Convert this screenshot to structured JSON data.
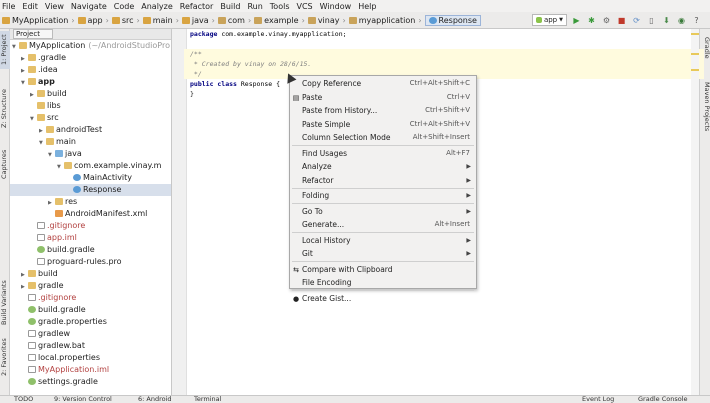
{
  "menubar": [
    "File",
    "Edit",
    "View",
    "Navigate",
    "Code",
    "Analyze",
    "Refactor",
    "Build",
    "Run",
    "Tools",
    "VCS",
    "Window",
    "Help"
  ],
  "breadcrumbs": [
    "MyApplication",
    "app",
    "src",
    "main",
    "java",
    "com",
    "example",
    "vinay",
    "myapplication",
    "Response"
  ],
  "toolbar": {
    "run_config": "app"
  },
  "left_tabs": [
    "1: Project",
    "Z: Structure",
    "Captures",
    "Build Variants",
    "2: Favorites"
  ],
  "right_tabs": [
    "Gradle",
    "Maven Projects"
  ],
  "project": {
    "view_label": "Project",
    "tree": [
      {
        "label": "MyApplication",
        "extra": "(~/AndroidStudioPro",
        "indent": 0,
        "arrow": "▼",
        "icon": "folder"
      },
      {
        "label": ".gradle",
        "indent": 1,
        "arrow": "▶",
        "icon": "folder"
      },
      {
        "label": ".idea",
        "indent": 1,
        "arrow": "▶",
        "icon": "folder"
      },
      {
        "label": "app",
        "indent": 1,
        "arrow": "▼",
        "icon": "folder",
        "bold": true
      },
      {
        "label": "build",
        "indent": 2,
        "arrow": "▶",
        "icon": "folder"
      },
      {
        "label": "libs",
        "indent": 2,
        "arrow": "",
        "icon": "folder"
      },
      {
        "label": "src",
        "indent": 2,
        "arrow": "▼",
        "icon": "folder"
      },
      {
        "label": "androidTest",
        "indent": 3,
        "arrow": "▶",
        "icon": "folder"
      },
      {
        "label": "main",
        "indent": 3,
        "arrow": "▼",
        "icon": "folder"
      },
      {
        "label": "java",
        "indent": 4,
        "arrow": "▼",
        "icon": "src"
      },
      {
        "label": "com.example.vinay.m",
        "indent": 5,
        "arrow": "▼",
        "icon": "folder"
      },
      {
        "label": "MainActivity",
        "indent": 6,
        "arrow": "",
        "icon": "cls"
      },
      {
        "label": "Response",
        "indent": 6,
        "arrow": "",
        "icon": "cls",
        "selected": true
      },
      {
        "label": "res",
        "indent": 4,
        "arrow": "▶",
        "icon": "folder"
      },
      {
        "label": "AndroidManifest.xml",
        "indent": 4,
        "arrow": "",
        "icon": "xml"
      },
      {
        "label": ".gitignore",
        "indent": 2,
        "arrow": "",
        "icon": "file"
      },
      {
        "label": "app.iml",
        "indent": 2,
        "arrow": "",
        "icon": "file"
      },
      {
        "label": "build.gradle",
        "indent": 2,
        "arrow": "",
        "icon": "gradle"
      },
      {
        "label": "proguard-rules.pro",
        "indent": 2,
        "arrow": "",
        "icon": "file"
      },
      {
        "label": "build",
        "indent": 1,
        "arrow": "▶",
        "icon": "folder"
      },
      {
        "label": "gradle",
        "indent": 1,
        "arrow": "▶",
        "icon": "folder"
      },
      {
        "label": ".gitignore",
        "indent": 1,
        "arrow": "",
        "icon": "file"
      },
      {
        "label": "build.gradle",
        "indent": 1,
        "arrow": "",
        "icon": "gradle"
      },
      {
        "label": "gradle.properties",
        "indent": 1,
        "arrow": "",
        "icon": "gradle"
      },
      {
        "label": "gradlew",
        "indent": 1,
        "arrow": "",
        "icon": "file"
      },
      {
        "label": "gradlew.bat",
        "indent": 1,
        "arrow": "",
        "icon": "file"
      },
      {
        "label": "local.properties",
        "indent": 1,
        "arrow": "",
        "icon": "file"
      },
      {
        "label": "MyApplication.iml",
        "indent": 1,
        "arrow": "",
        "icon": "file"
      },
      {
        "label": "settings.gradle",
        "indent": 1,
        "arrow": "",
        "icon": "gradle"
      }
    ]
  },
  "editor": {
    "lines": [
      {
        "text": "package com.example.vinay.myapplication;",
        "style": "pkg"
      },
      {
        "text": "",
        "style": "plain"
      },
      {
        "text": "/**",
        "style": "cmt"
      },
      {
        "text": " * Created by vinay on 28/6/15.",
        "style": "cmt"
      },
      {
        "text": " */",
        "style": "cmt"
      },
      {
        "text": "public class Response {",
        "style": "cls"
      },
      {
        "text": "}",
        "style": "plain"
      }
    ]
  },
  "context_menu": [
    {
      "label": "Copy Reference",
      "shortcut": "Ctrl+Alt+Shift+C"
    },
    {
      "label": "Paste",
      "shortcut": "Ctrl+V",
      "icon": "paste-icon"
    },
    {
      "label": "Paste from History...",
      "shortcut": "Ctrl+Shift+V"
    },
    {
      "label": "Paste Simple",
      "shortcut": "Ctrl+Alt+Shift+V"
    },
    {
      "label": "Column Selection Mode",
      "shortcut": "Alt+Shift+Insert"
    },
    {
      "sep": true
    },
    {
      "label": "Find Usages",
      "shortcut": "Alt+F7"
    },
    {
      "label": "Analyze",
      "submenu": true
    },
    {
      "label": "Refactor",
      "submenu": true
    },
    {
      "sep": true
    },
    {
      "label": "Folding",
      "submenu": true
    },
    {
      "sep": true
    },
    {
      "label": "Go To",
      "submenu": true
    },
    {
      "label": "Generate...",
      "shortcut": "Alt+Insert"
    },
    {
      "sep": true
    },
    {
      "label": "Local History",
      "submenu": true
    },
    {
      "label": "Git",
      "submenu": true
    },
    {
      "sep": true
    },
    {
      "label": "Compare with Clipboard",
      "icon": "compare-icon"
    },
    {
      "label": "File Encoding"
    },
    {
      "sep": true
    },
    {
      "label": "Create Gist...",
      "icon": "github-icon"
    }
  ],
  "statusbar": {
    "todo": "TODO",
    "vcs": "9: Version Control",
    "android": "6: Android",
    "terminal": "Terminal",
    "event_log": "Event Log",
    "gradle_console": "Gradle Console"
  }
}
